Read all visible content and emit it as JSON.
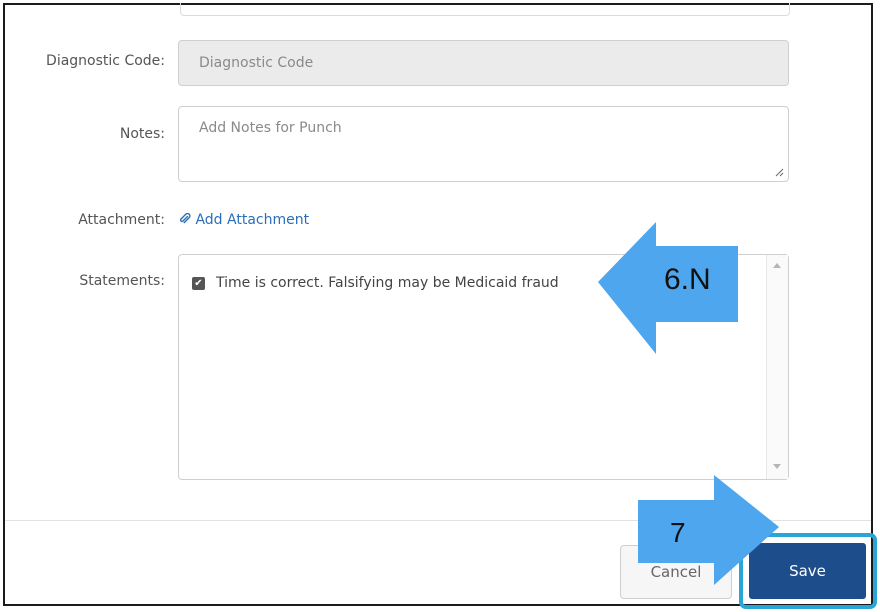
{
  "form": {
    "diagnostic_label": "Diagnostic Code:",
    "diagnostic_placeholder": "Diagnostic Code",
    "notes_label": "Notes:",
    "notes_placeholder": "Add Notes for Punch",
    "attachment_label": "Attachment:",
    "attachment_link": "Add Attachment",
    "statements_label": "Statements:",
    "statement_text": "Time is correct. Falsifying may be Medicaid fraud",
    "statement_checked": true
  },
  "footer": {
    "cancel_label": "Cancel",
    "save_label": "Save"
  },
  "annotations": {
    "step_6": "6.N",
    "step_7": "7"
  },
  "colors": {
    "callout_arrow": "#4ea6ee",
    "save_button": "#1e4d8c",
    "save_highlight": "#2aa5d8",
    "link": "#2a6ebb"
  },
  "icons": {
    "attachment": "paperclip-icon",
    "checkbox": "checkmark-icon"
  }
}
